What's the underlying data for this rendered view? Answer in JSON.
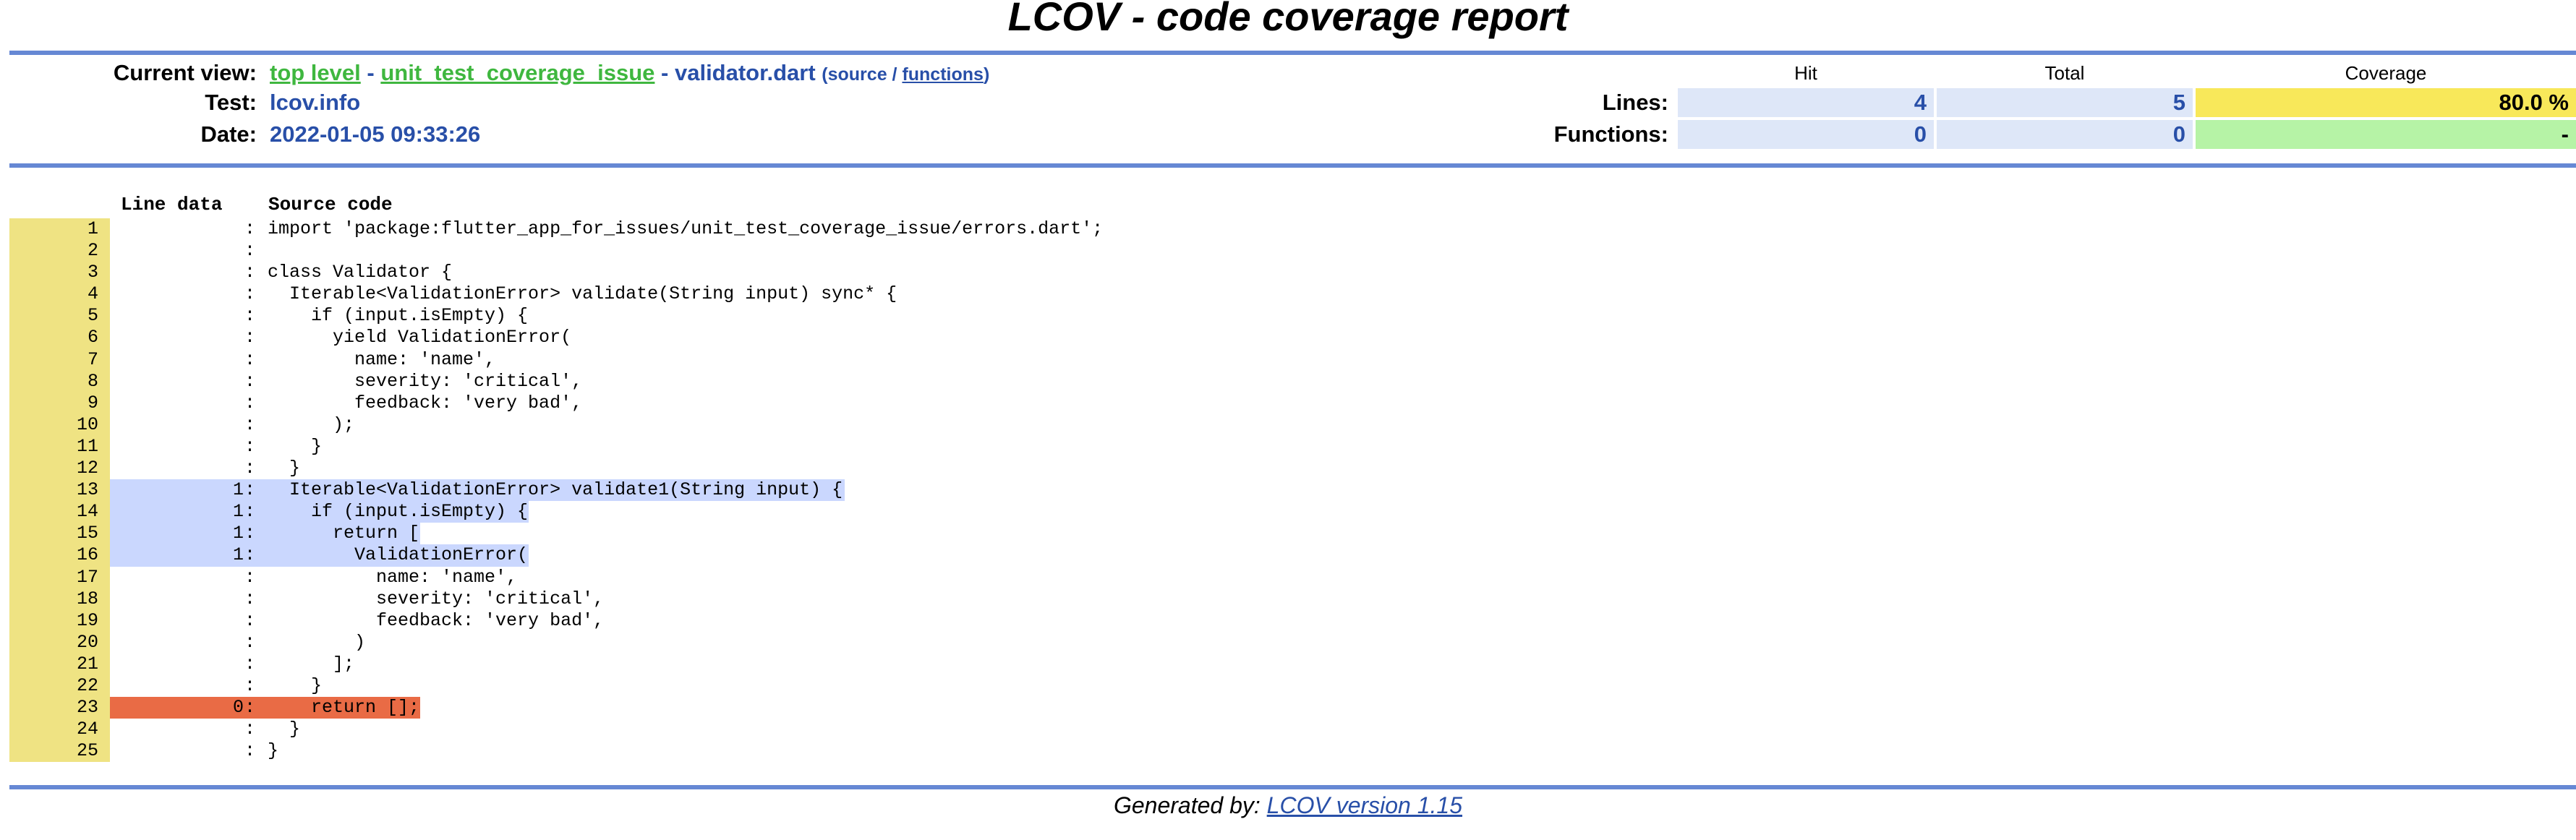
{
  "title": "LCOV - code coverage report",
  "header": {
    "current_view_label": "Current view:",
    "breadcrumb": {
      "top_level": "top level",
      "sep1": " - ",
      "directory": "unit_test_coverage_issue",
      "sep2": " - ",
      "file": "validator.dart",
      "view_open": "(",
      "source_label": "source",
      "view_sep": " / ",
      "functions_label": "functions",
      "view_close": ")"
    },
    "test_label": "Test:",
    "test_value": "lcov.info",
    "date_label": "Date:",
    "date_value": "2022-01-05 09:33:26"
  },
  "stats": {
    "col_hit": "Hit",
    "col_total": "Total",
    "col_coverage": "Coverage",
    "lines_label": "Lines:",
    "lines_hit": "4",
    "lines_total": "5",
    "lines_coverage": "80.0 %",
    "functions_label": "Functions:",
    "functions_hit": "0",
    "functions_total": "0",
    "functions_coverage": "-"
  },
  "code_header": {
    "line_data": "Line data",
    "source_code": "Source code"
  },
  "colors": {
    "ruler": "#6688d4",
    "line_number_bg": "#efe383",
    "hit_bg": "#cad7fe",
    "miss_bg": "#e96b45",
    "coverage_medium": "#f8e85a",
    "coverage_none": "#b6f3a6",
    "link_green": "#3fb73f",
    "link_blue": "#284fa8"
  },
  "lines": [
    {
      "n": "1",
      "hits": "",
      "status": "none",
      "src": "import 'package:flutter_app_for_issues/unit_test_coverage_issue/errors.dart';"
    },
    {
      "n": "2",
      "hits": "",
      "status": "none",
      "src": ""
    },
    {
      "n": "3",
      "hits": "",
      "status": "none",
      "src": "class Validator {"
    },
    {
      "n": "4",
      "hits": "",
      "status": "none",
      "src": "  Iterable<ValidationError> validate(String input) sync* {"
    },
    {
      "n": "5",
      "hits": "",
      "status": "none",
      "src": "    if (input.isEmpty) {"
    },
    {
      "n": "6",
      "hits": "",
      "status": "none",
      "src": "      yield ValidationError("
    },
    {
      "n": "7",
      "hits": "",
      "status": "none",
      "src": "        name: 'name',"
    },
    {
      "n": "8",
      "hits": "",
      "status": "none",
      "src": "        severity: 'critical',"
    },
    {
      "n": "9",
      "hits": "",
      "status": "none",
      "src": "        feedback: 'very bad',"
    },
    {
      "n": "10",
      "hits": "",
      "status": "none",
      "src": "      );"
    },
    {
      "n": "11",
      "hits": "",
      "status": "none",
      "src": "    }"
    },
    {
      "n": "12",
      "hits": "",
      "status": "none",
      "src": "  }"
    },
    {
      "n": "13",
      "hits": "1",
      "status": "hit",
      "src": "  Iterable<ValidationError> validate1(String input) {"
    },
    {
      "n": "14",
      "hits": "1",
      "status": "hit",
      "src": "    if (input.isEmpty) {"
    },
    {
      "n": "15",
      "hits": "1",
      "status": "hit",
      "src": "      return ["
    },
    {
      "n": "16",
      "hits": "1",
      "status": "hit",
      "src": "        ValidationError("
    },
    {
      "n": "17",
      "hits": "",
      "status": "none",
      "src": "          name: 'name',"
    },
    {
      "n": "18",
      "hits": "",
      "status": "none",
      "src": "          severity: 'critical',"
    },
    {
      "n": "19",
      "hits": "",
      "status": "none",
      "src": "          feedback: 'very bad',"
    },
    {
      "n": "20",
      "hits": "",
      "status": "none",
      "src": "        )"
    },
    {
      "n": "21",
      "hits": "",
      "status": "none",
      "src": "      ];"
    },
    {
      "n": "22",
      "hits": "",
      "status": "none",
      "src": "    }"
    },
    {
      "n": "23",
      "hits": "0",
      "status": "miss",
      "src": "    return [];"
    },
    {
      "n": "24",
      "hits": "",
      "status": "none",
      "src": "  }"
    },
    {
      "n": "25",
      "hits": "",
      "status": "none",
      "src": "}"
    }
  ],
  "footer": {
    "generated_by": "Generated by: ",
    "lcov_link": "LCOV version 1.15"
  }
}
